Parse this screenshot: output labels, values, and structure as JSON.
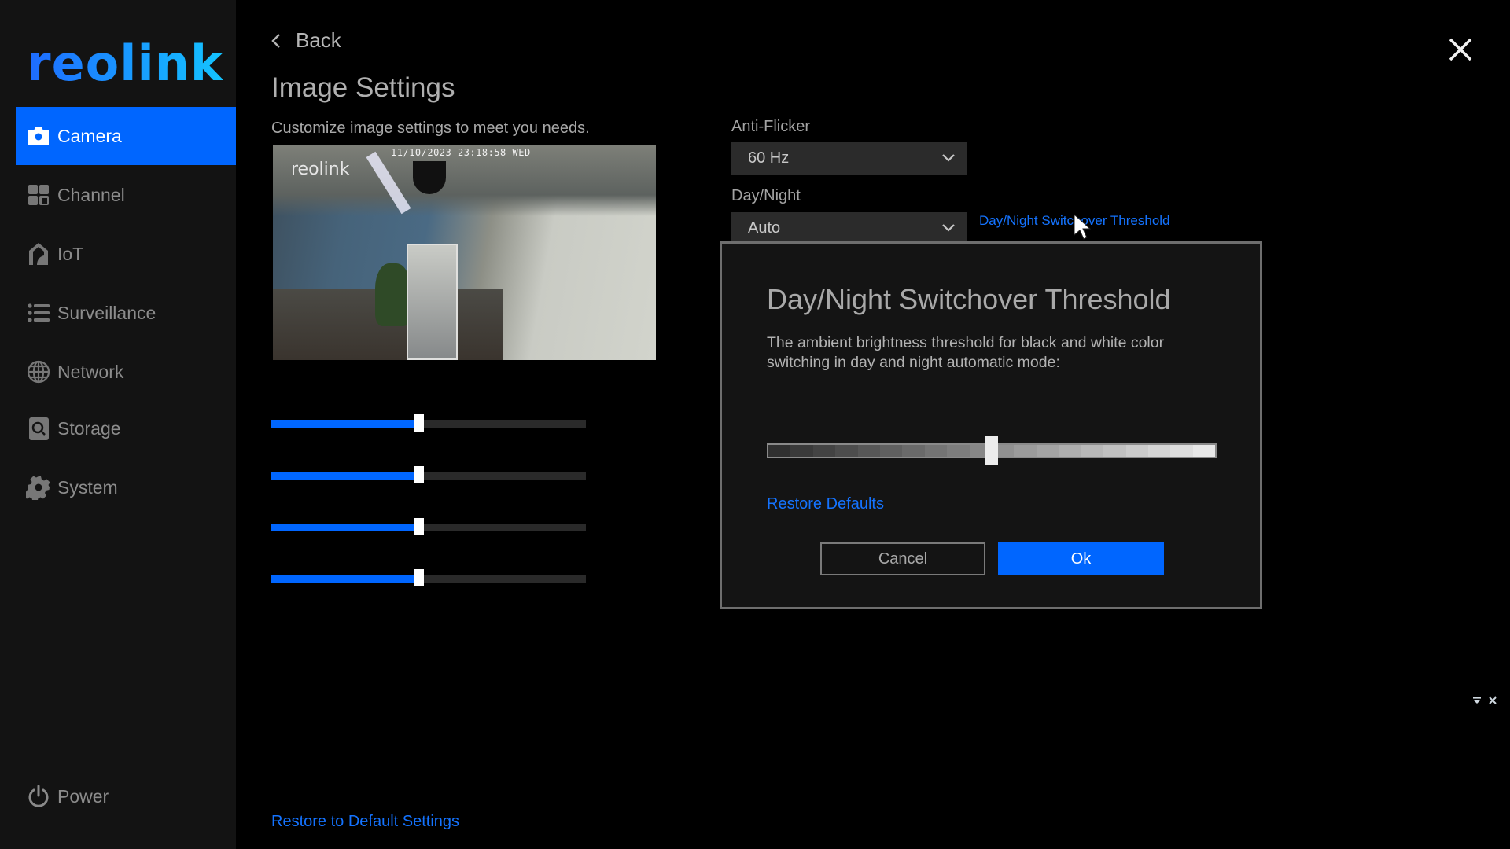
{
  "brand": {
    "logo_text": "reolink",
    "accent_color": "#0066ff",
    "link_color": "#1473ff"
  },
  "sidebar": {
    "items": [
      {
        "label": "Camera",
        "icon": "camera-icon",
        "active": true
      },
      {
        "label": "Channel",
        "icon": "channel-grid-icon",
        "active": false
      },
      {
        "label": "IoT",
        "icon": "iot-home-icon",
        "active": false
      },
      {
        "label": "Surveillance",
        "icon": "list-icon",
        "active": false
      },
      {
        "label": "Network",
        "icon": "globe-icon",
        "active": false
      },
      {
        "label": "Storage",
        "icon": "storage-icon",
        "active": false
      },
      {
        "label": "System",
        "icon": "gear-icon",
        "active": false
      }
    ],
    "power_label": "Power"
  },
  "header": {
    "back_label": "Back",
    "title": "Image Settings",
    "subtitle": "Customize image settings to meet you needs."
  },
  "preview": {
    "watermark": "reolink",
    "timestamp": "11/10/2023 23:18:58 WED"
  },
  "image_sliders": [
    {
      "value_fraction": 0.5
    },
    {
      "value_fraction": 0.5
    },
    {
      "value_fraction": 0.5
    },
    {
      "value_fraction": 0.5
    }
  ],
  "settings": {
    "anti_flicker": {
      "label": "Anti-Flicker",
      "value": "60 Hz"
    },
    "day_night": {
      "label": "Day/Night",
      "value": "Auto"
    },
    "threshold_link": "Day/Night Switchover Threshold"
  },
  "footer": {
    "restore_link": "Restore to Default Settings"
  },
  "modal": {
    "title": "Day/Night Switchover Threshold",
    "description": "The ambient brightness threshold for black and white color switching in day and night automatic mode:",
    "threshold_value_fraction": 0.5,
    "restore_label": "Restore Defaults",
    "cancel_label": "Cancel",
    "ok_label": "Ok"
  }
}
